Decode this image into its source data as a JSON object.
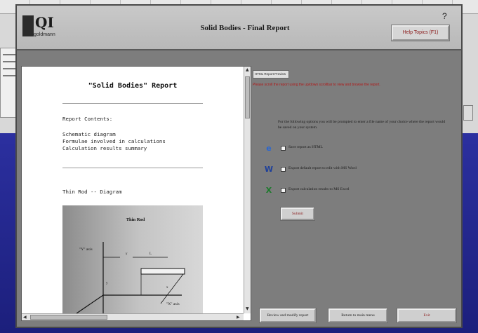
{
  "window": {
    "title": "Solid Bodies - Final Report",
    "help_label": "Help Topics (F1)",
    "close_glyph": "?"
  },
  "logo": {
    "text": "QI",
    "sub": "goldmann"
  },
  "report": {
    "title": "\"Solid Bodies\" Report",
    "contents_heading": "Report Contents:",
    "contents_lines": "Schematic diagram\nFormulae involved in calculations\nCalculation results summary",
    "section_heading": "Thin Rod -- Diagram",
    "diagram": {
      "title": "Thin Rod",
      "y_axis": "\"Y\" axis",
      "x_axis": "\"X\" axis",
      "mark_a": "y",
      "mark_b": "L",
      "mark_c": "x",
      "mark_d": "y"
    }
  },
  "panel": {
    "preview_tab": "HTML Report Preview",
    "notice": "Please scroll the report using the up/down scrollbar to view and browse the report.",
    "instructions": "For the following options you will be prompted to enter a file name of your choice where the report would be saved on your system.",
    "options": [
      {
        "icon": "internet-explorer-icon",
        "glyph": "e",
        "color": "#2a66d0",
        "label": "Save report as HTML"
      },
      {
        "icon": "ms-word-icon",
        "glyph": "W",
        "color": "#1d3f9a",
        "label": "Export default report to edit with MS Word"
      },
      {
        "icon": "ms-excel-icon",
        "glyph": "X",
        "color": "#1b7a2b",
        "label": "Export calculation results to MS Excel"
      }
    ],
    "submit_label": "Submit"
  },
  "footer": {
    "review_label": "Review and modify report",
    "return_label": "Return to main menu",
    "exit_label": "Exit"
  }
}
